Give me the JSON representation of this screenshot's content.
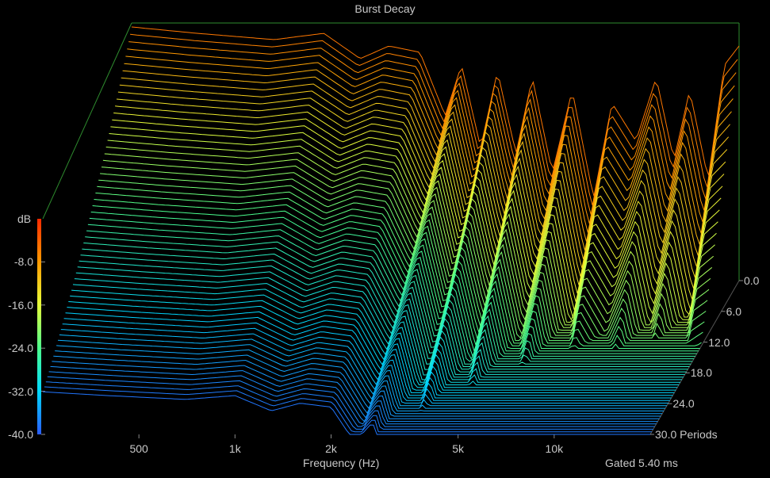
{
  "chart_data": {
    "type": "waterfall",
    "title": "Burst Decay",
    "xlabel": "Frequency (Hz)",
    "zlabel": "dB",
    "x_scale": "log",
    "x_ticks": [
      {
        "value": 500,
        "label": "500"
      },
      {
        "value": 1000,
        "label": "1k"
      },
      {
        "value": 2000,
        "label": "2k"
      },
      {
        "value": 5000,
        "label": "5k"
      },
      {
        "value": 10000,
        "label": "10k"
      }
    ],
    "xlim": [
      250,
      20000
    ],
    "z_ticks": [
      {
        "value": -8,
        "label": "-8.0"
      },
      {
        "value": -16,
        "label": "-16.0"
      },
      {
        "value": -24,
        "label": "-24.0"
      },
      {
        "value": -32,
        "label": "-32.0"
      },
      {
        "value": -40,
        "label": "-40.0"
      }
    ],
    "zlim": [
      -40,
      0
    ],
    "depth_ticks": [
      {
        "value": 0,
        "label": "0.0"
      },
      {
        "value": 6,
        "label": "6.0"
      },
      {
        "value": 12,
        "label": "12.0"
      },
      {
        "value": 18,
        "label": "18.0"
      },
      {
        "value": 24,
        "label": "24.0"
      },
      {
        "value": 30,
        "label": "30.0 Periods"
      }
    ],
    "depth_range": [
      0,
      30
    ],
    "note": "Gated 5.40 ms",
    "colormap": [
      "#2a5cff",
      "#00d8ff",
      "#4cff8c",
      "#e6ff3a",
      "#ff9a00",
      "#ff2a00"
    ],
    "slice_count": 60,
    "surface_profile": [
      [
        250,
        0
      ],
      [
        400,
        -1
      ],
      [
        700,
        -2
      ],
      [
        1000,
        -1
      ],
      [
        1300,
        -5
      ],
      [
        1600,
        -3
      ],
      [
        2000,
        -4
      ],
      [
        2400,
        -14
      ],
      [
        2700,
        -6
      ],
      [
        3100,
        -19
      ],
      [
        3500,
        -7
      ],
      [
        4000,
        -20
      ],
      [
        4500,
        -8
      ],
      [
        5200,
        -23
      ],
      [
        6000,
        -10
      ],
      [
        7000,
        -27
      ],
      [
        8000,
        -12
      ],
      [
        9500,
        -18
      ],
      [
        11000,
        -8
      ],
      [
        12500,
        -21
      ],
      [
        14000,
        -10
      ],
      [
        16000,
        -24
      ],
      [
        18000,
        -6
      ],
      [
        20000,
        -3
      ]
    ]
  }
}
